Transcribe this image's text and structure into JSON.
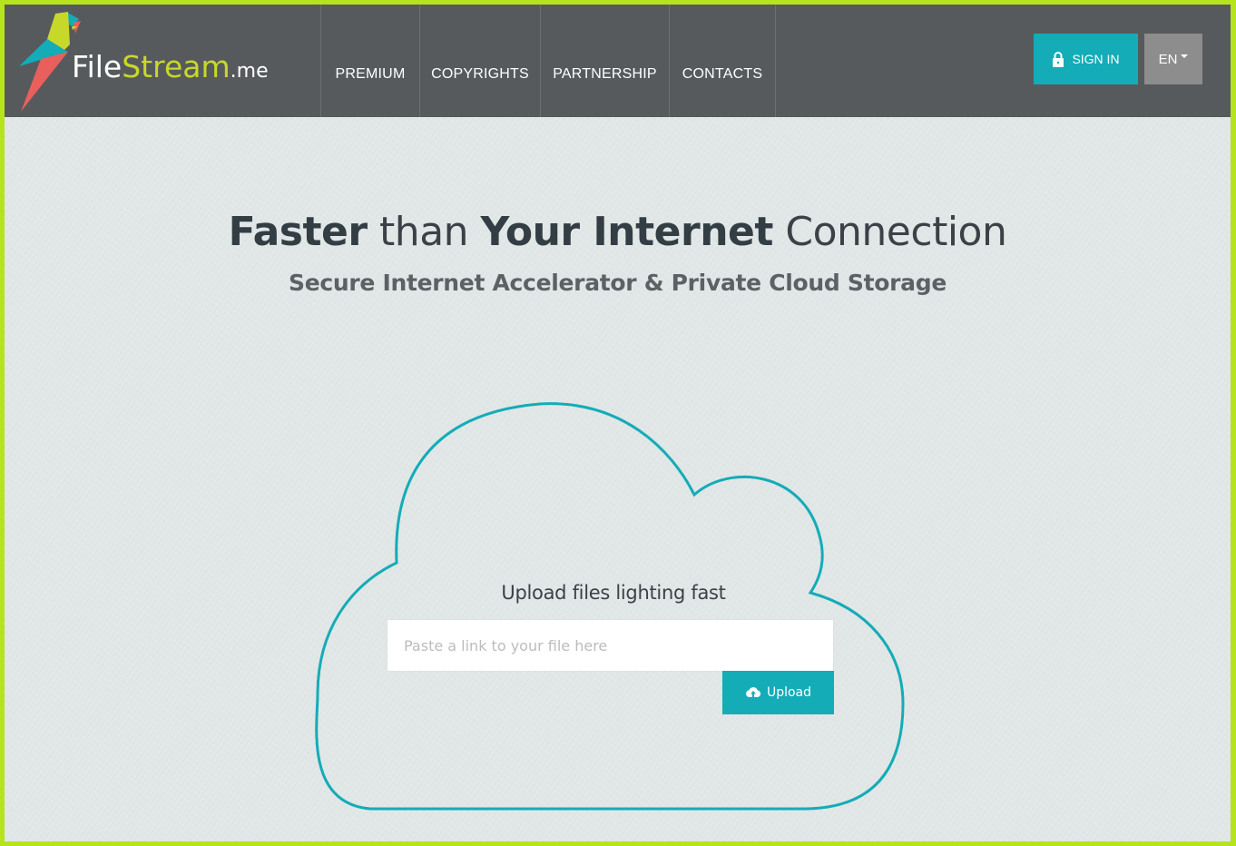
{
  "brand": {
    "name_part1": "File",
    "name_part2": "Stream",
    "name_suffix": ".me",
    "colors": {
      "frame": "#b5e31c",
      "header_bg": "#575a5d",
      "accent": "#13acb7",
      "lang_bg": "#8c8d8c",
      "logo_yellow": "#c8d82a",
      "logo_red": "#e85f5c",
      "logo_teal": "#13acb7"
    }
  },
  "nav": {
    "items": [
      {
        "label": "PREMIUM"
      },
      {
        "label": "COPYRIGHTS"
      },
      {
        "label": "PARTNERSHIP"
      },
      {
        "label": "CONTACTS"
      }
    ]
  },
  "header": {
    "signin_label": "SIGN IN",
    "signin_icon": "lock-icon",
    "language": "EN"
  },
  "hero": {
    "title_parts": [
      "Faster",
      " than ",
      "Your Internet",
      " Connection"
    ],
    "subtitle": "Secure Internet Accelerator & Private Cloud Storage"
  },
  "upload": {
    "heading": "Upload files lighting fast",
    "input_placeholder": "Paste a link to your file here",
    "input_value": "",
    "button_label": "Upload",
    "button_icon": "cloud-upload-icon"
  }
}
